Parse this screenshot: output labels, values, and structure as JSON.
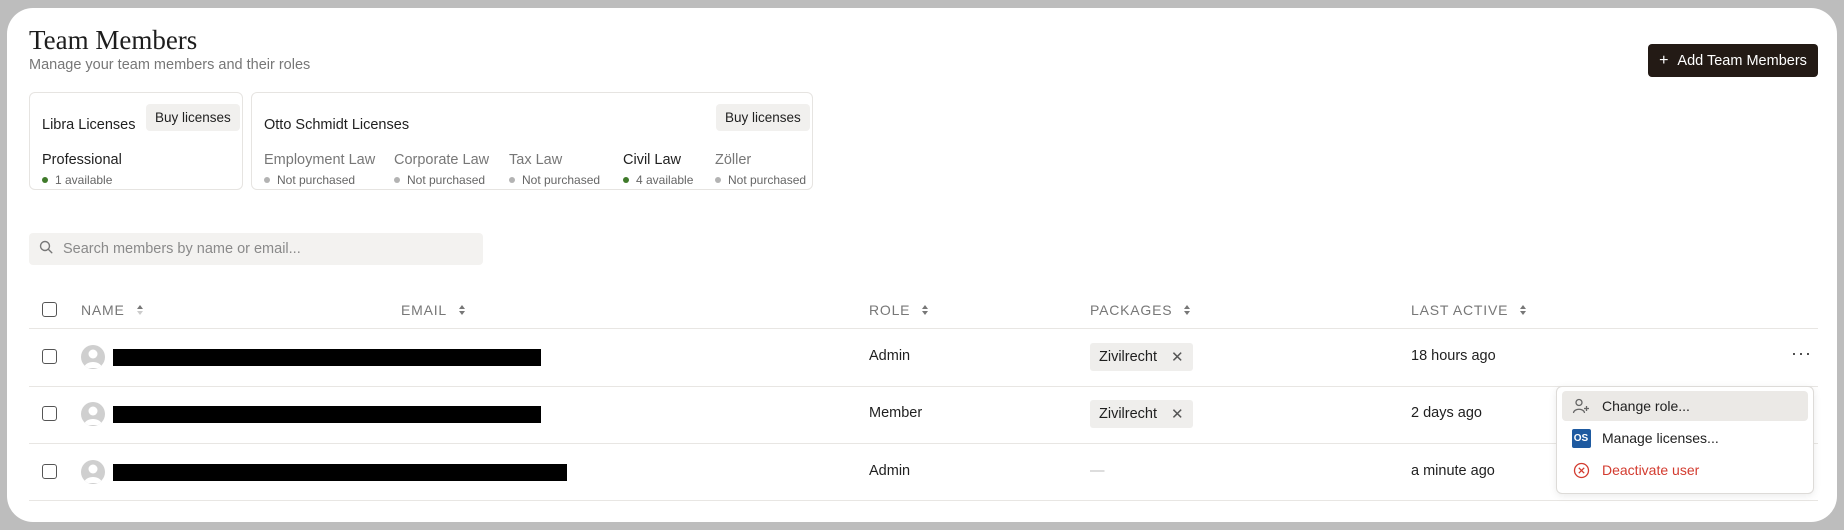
{
  "header": {
    "title": "Team Members",
    "subtitle": "Manage your team members and their roles",
    "add_button_icon": "plus-icon",
    "add_button_label": "Add Team Members"
  },
  "licenses": {
    "libra": {
      "title": "Libra Licenses",
      "buy_label": "Buy licenses",
      "packages": [
        {
          "name": "Professional",
          "status": "1 available",
          "status_color": "#3f7a2a"
        }
      ]
    },
    "otto": {
      "title": "Otto Schmidt Licenses",
      "buy_label": "Buy licenses",
      "packages": [
        {
          "name": "Employment Law",
          "status": "Not purchased",
          "status_color": "#b3b3b3"
        },
        {
          "name": "Corporate Law",
          "status": "Not purchased",
          "status_color": "#b3b3b3"
        },
        {
          "name": "Tax Law",
          "status": "Not purchased",
          "status_color": "#b3b3b3"
        },
        {
          "name": "Civil Law",
          "status": "4 available",
          "status_color": "#3f7a2a"
        },
        {
          "name": "Zöller",
          "status": "Not purchased",
          "status_color": "#b3b3b3"
        }
      ]
    }
  },
  "search": {
    "icon": "search-icon",
    "placeholder": "Search members by name or email..."
  },
  "table": {
    "columns": [
      "NAME",
      "EMAIL",
      "ROLE",
      "PACKAGES",
      "LAST ACTIVE"
    ],
    "rows": [
      {
        "role": "Admin",
        "packages": [
          "Zivilrecht"
        ],
        "last_active": "18 hours ago"
      },
      {
        "role": "Member",
        "packages": [
          "Zivilrecht"
        ],
        "last_active": "2 days ago"
      },
      {
        "role": "Admin",
        "packages_empty": "—",
        "last_active": "a minute ago"
      }
    ],
    "row_actions_label": "···"
  },
  "context_menu": {
    "items": [
      {
        "label": "Change role...",
        "icon": "user-plus-icon"
      },
      {
        "label": "Manage licenses...",
        "icon": "os-badge-icon",
        "icon_text": "OS"
      },
      {
        "label": "Deactivate user",
        "icon": "x-circle-icon"
      }
    ]
  },
  "colors": {
    "primary_button": "#231a15",
    "available": "#3f7a2a",
    "danger": "#d33b2f",
    "os_badge": "#1e5aa0"
  }
}
